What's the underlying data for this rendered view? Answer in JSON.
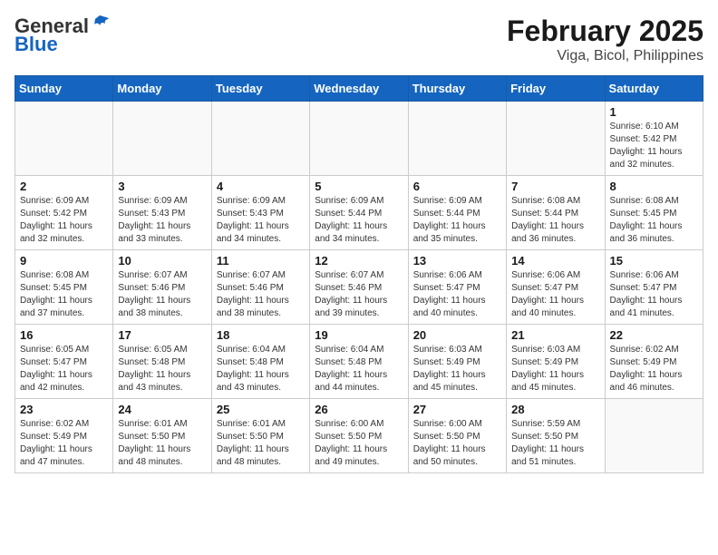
{
  "header": {
    "logo_general": "General",
    "logo_blue": "Blue",
    "title": "February 2025",
    "subtitle": "Viga, Bicol, Philippines"
  },
  "calendar": {
    "days_of_week": [
      "Sunday",
      "Monday",
      "Tuesday",
      "Wednesday",
      "Thursday",
      "Friday",
      "Saturday"
    ],
    "weeks": [
      [
        {
          "day": "",
          "info": ""
        },
        {
          "day": "",
          "info": ""
        },
        {
          "day": "",
          "info": ""
        },
        {
          "day": "",
          "info": ""
        },
        {
          "day": "",
          "info": ""
        },
        {
          "day": "",
          "info": ""
        },
        {
          "day": "1",
          "info": "Sunrise: 6:10 AM\nSunset: 5:42 PM\nDaylight: 11 hours and 32 minutes."
        }
      ],
      [
        {
          "day": "2",
          "info": "Sunrise: 6:09 AM\nSunset: 5:42 PM\nDaylight: 11 hours and 32 minutes."
        },
        {
          "day": "3",
          "info": "Sunrise: 6:09 AM\nSunset: 5:43 PM\nDaylight: 11 hours and 33 minutes."
        },
        {
          "day": "4",
          "info": "Sunrise: 6:09 AM\nSunset: 5:43 PM\nDaylight: 11 hours and 34 minutes."
        },
        {
          "day": "5",
          "info": "Sunrise: 6:09 AM\nSunset: 5:44 PM\nDaylight: 11 hours and 34 minutes."
        },
        {
          "day": "6",
          "info": "Sunrise: 6:09 AM\nSunset: 5:44 PM\nDaylight: 11 hours and 35 minutes."
        },
        {
          "day": "7",
          "info": "Sunrise: 6:08 AM\nSunset: 5:44 PM\nDaylight: 11 hours and 36 minutes."
        },
        {
          "day": "8",
          "info": "Sunrise: 6:08 AM\nSunset: 5:45 PM\nDaylight: 11 hours and 36 minutes."
        }
      ],
      [
        {
          "day": "9",
          "info": "Sunrise: 6:08 AM\nSunset: 5:45 PM\nDaylight: 11 hours and 37 minutes."
        },
        {
          "day": "10",
          "info": "Sunrise: 6:07 AM\nSunset: 5:46 PM\nDaylight: 11 hours and 38 minutes."
        },
        {
          "day": "11",
          "info": "Sunrise: 6:07 AM\nSunset: 5:46 PM\nDaylight: 11 hours and 38 minutes."
        },
        {
          "day": "12",
          "info": "Sunrise: 6:07 AM\nSunset: 5:46 PM\nDaylight: 11 hours and 39 minutes."
        },
        {
          "day": "13",
          "info": "Sunrise: 6:06 AM\nSunset: 5:47 PM\nDaylight: 11 hours and 40 minutes."
        },
        {
          "day": "14",
          "info": "Sunrise: 6:06 AM\nSunset: 5:47 PM\nDaylight: 11 hours and 40 minutes."
        },
        {
          "day": "15",
          "info": "Sunrise: 6:06 AM\nSunset: 5:47 PM\nDaylight: 11 hours and 41 minutes."
        }
      ],
      [
        {
          "day": "16",
          "info": "Sunrise: 6:05 AM\nSunset: 5:47 PM\nDaylight: 11 hours and 42 minutes."
        },
        {
          "day": "17",
          "info": "Sunrise: 6:05 AM\nSunset: 5:48 PM\nDaylight: 11 hours and 43 minutes."
        },
        {
          "day": "18",
          "info": "Sunrise: 6:04 AM\nSunset: 5:48 PM\nDaylight: 11 hours and 43 minutes."
        },
        {
          "day": "19",
          "info": "Sunrise: 6:04 AM\nSunset: 5:48 PM\nDaylight: 11 hours and 44 minutes."
        },
        {
          "day": "20",
          "info": "Sunrise: 6:03 AM\nSunset: 5:49 PM\nDaylight: 11 hours and 45 minutes."
        },
        {
          "day": "21",
          "info": "Sunrise: 6:03 AM\nSunset: 5:49 PM\nDaylight: 11 hours and 45 minutes."
        },
        {
          "day": "22",
          "info": "Sunrise: 6:02 AM\nSunset: 5:49 PM\nDaylight: 11 hours and 46 minutes."
        }
      ],
      [
        {
          "day": "23",
          "info": "Sunrise: 6:02 AM\nSunset: 5:49 PM\nDaylight: 11 hours and 47 minutes."
        },
        {
          "day": "24",
          "info": "Sunrise: 6:01 AM\nSunset: 5:50 PM\nDaylight: 11 hours and 48 minutes."
        },
        {
          "day": "25",
          "info": "Sunrise: 6:01 AM\nSunset: 5:50 PM\nDaylight: 11 hours and 48 minutes."
        },
        {
          "day": "26",
          "info": "Sunrise: 6:00 AM\nSunset: 5:50 PM\nDaylight: 11 hours and 49 minutes."
        },
        {
          "day": "27",
          "info": "Sunrise: 6:00 AM\nSunset: 5:50 PM\nDaylight: 11 hours and 50 minutes."
        },
        {
          "day": "28",
          "info": "Sunrise: 5:59 AM\nSunset: 5:50 PM\nDaylight: 11 hours and 51 minutes."
        },
        {
          "day": "",
          "info": ""
        }
      ]
    ]
  }
}
